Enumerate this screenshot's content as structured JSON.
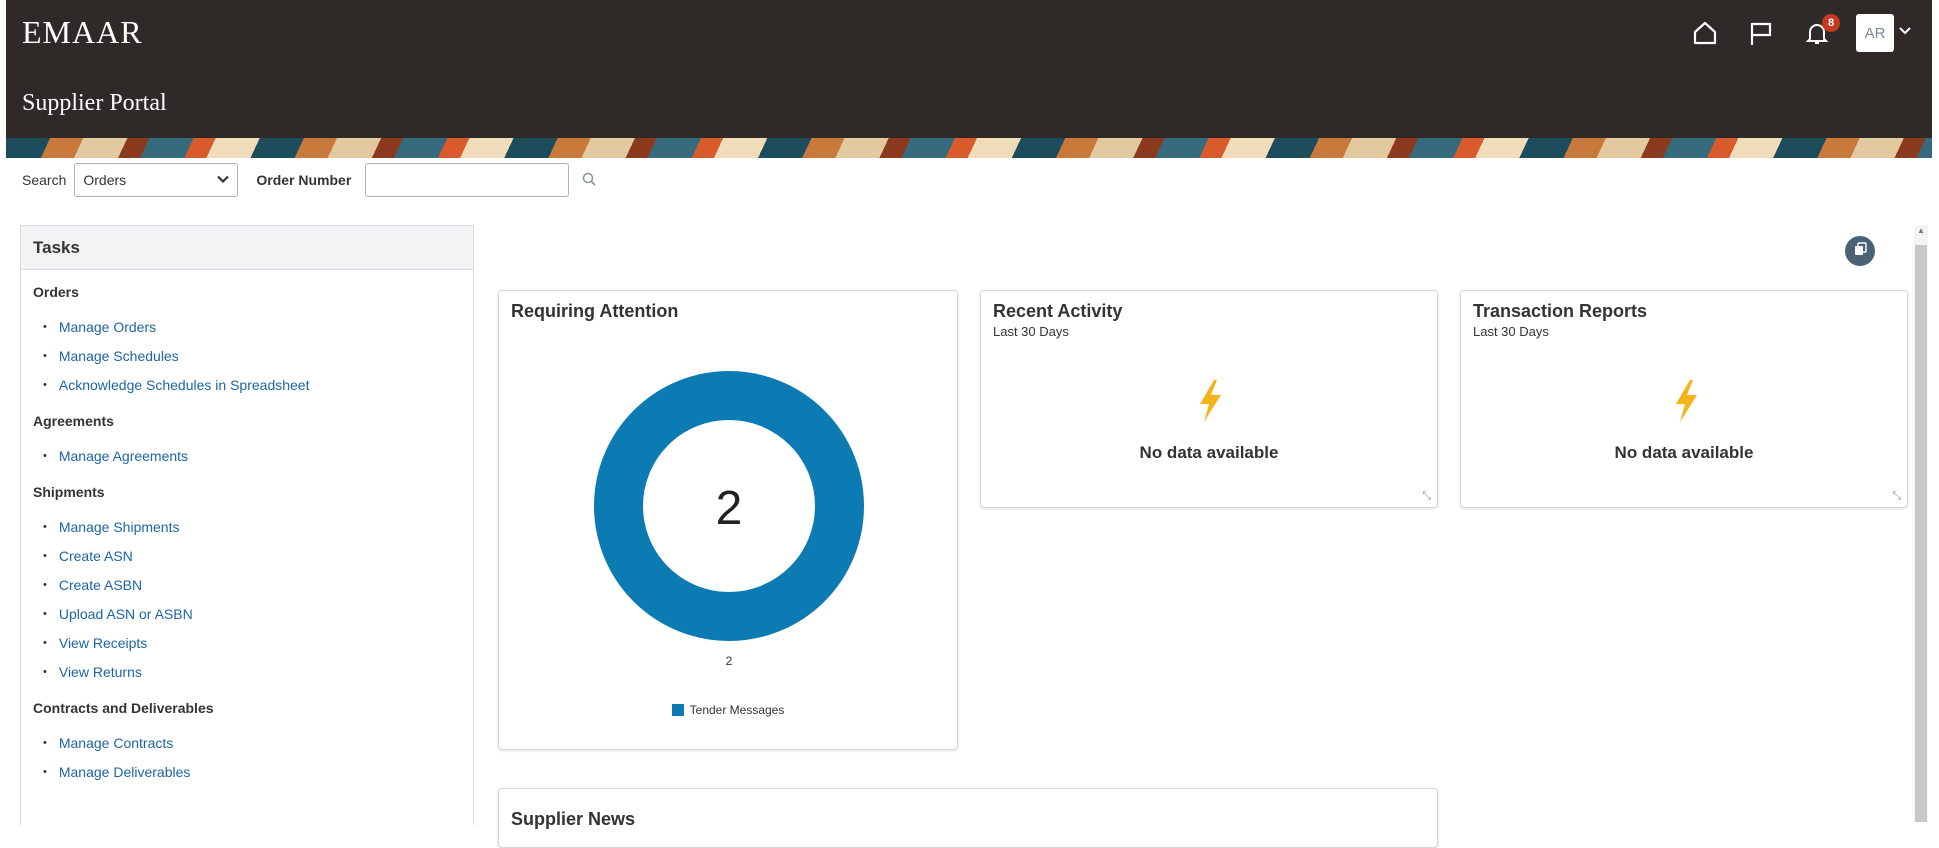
{
  "header": {
    "logo": "EMAAR",
    "portal_title": "Supplier Portal",
    "notifications_count": "8",
    "avatar_initials": "AR"
  },
  "search": {
    "label": "Search",
    "selected_option": "Orders",
    "field_label": "Order Number",
    "value": ""
  },
  "tasks": {
    "title": "Tasks",
    "groups": [
      {
        "title": "Orders",
        "items": [
          "Manage Orders",
          "Manage Schedules",
          "Acknowledge Schedules in Spreadsheet"
        ]
      },
      {
        "title": "Agreements",
        "items": [
          "Manage Agreements"
        ]
      },
      {
        "title": "Shipments",
        "items": [
          "Manage Shipments",
          "Create ASN",
          "Create ASBN",
          "Upload ASN or ASBN",
          "View Receipts",
          "View Returns"
        ]
      },
      {
        "title": "Contracts and Deliverables",
        "items": [
          "Manage Contracts",
          "Manage Deliverables"
        ]
      }
    ]
  },
  "cards": {
    "requiring_attention": {
      "title": "Requiring Attention",
      "total": "2",
      "slice_label": "2",
      "legend": "Tender Messages"
    },
    "recent_activity": {
      "title": "Recent Activity",
      "subtitle": "Last 30 Days",
      "message": "No data available"
    },
    "transaction_reports": {
      "title": "Transaction Reports",
      "subtitle": "Last 30 Days",
      "message": "No data available"
    },
    "supplier_news": {
      "title": "Supplier News"
    }
  },
  "chart_data": {
    "type": "pie",
    "categories": [
      "Tender Messages"
    ],
    "values": [
      2
    ],
    "title": "Requiring Attention",
    "center_label": "2",
    "legend_position": "bottom",
    "colors": [
      "#0c7bb3"
    ]
  },
  "colors": {
    "header_bg": "#2f2927",
    "link": "#1c65a5",
    "donut": "#0c7bb3",
    "badge": "#c43a20",
    "bolt": "#f5b31b"
  }
}
